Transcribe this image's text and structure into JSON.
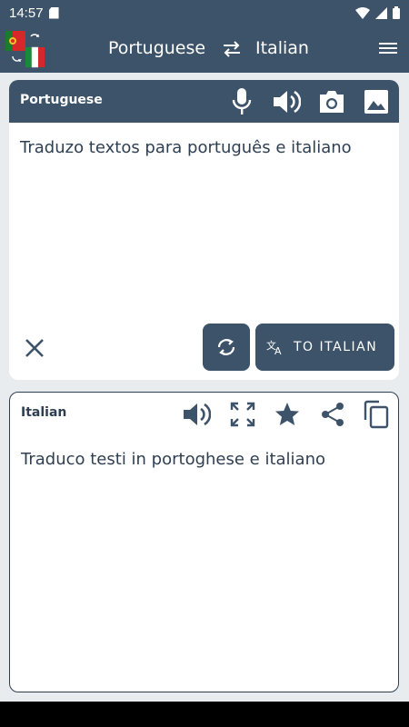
{
  "status_bar": {
    "time": "14:57"
  },
  "app_bar": {
    "source_language": "Portuguese",
    "target_language": "Italian"
  },
  "source_card": {
    "label": "Portuguese",
    "text": "Traduzo textos para português e italiano",
    "translate_button_label": "TO ITALIAN"
  },
  "target_card": {
    "label": "Italian",
    "text": "Traduco testi in portoghese e italiano"
  },
  "colors": {
    "primary": "#3d5369",
    "text": "#2f3f52",
    "background": "#e9ecef"
  }
}
